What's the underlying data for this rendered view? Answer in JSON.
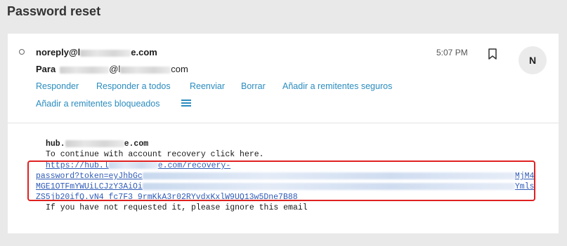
{
  "page": {
    "title": "Password reset"
  },
  "email": {
    "sender_prefix": "noreply@l",
    "sender_suffix": "e.com",
    "recipient_label": "Para",
    "recipient_at": "@l",
    "recipient_suffix": "com",
    "time": "5:07 PM",
    "avatar_initial": "N"
  },
  "actions": {
    "reply": "Responder",
    "reply_all": "Responder a todos",
    "forward": "Reenviar",
    "delete": "Borrar",
    "add_safe_senders": "Añadir a remitentes seguros",
    "add_blocked_senders": "Añadir a remitentes bloqueados"
  },
  "body": {
    "host_prefix": "hub.",
    "host_suffix": "e.com",
    "instruction": "To continue with account recovery click here.",
    "link_line1_prefix": "https://hub.l",
    "link_line1_suffix": "e.com/recovery-",
    "link_line2_prefix": "password?token=eyJhbGc",
    "link_line2_suffix": "MjM4",
    "link_line3_prefix": "MGE1OTFmYWUiLCJzY3AiOi",
    "link_line3_suffix": "Ymls",
    "link_line4": "ZS5jb20ifQ.vN4 fc7F3 9rmKkA3r02RYvdxKxlW9UQ13w5Dne7B88",
    "footer": "If you have not requested it, please ignore this email"
  },
  "colors": {
    "link": "#2a8cbf",
    "highlight": "#e02020"
  },
  "icons": [
    "radio-icon",
    "bookmark-icon",
    "menu-icon"
  ]
}
